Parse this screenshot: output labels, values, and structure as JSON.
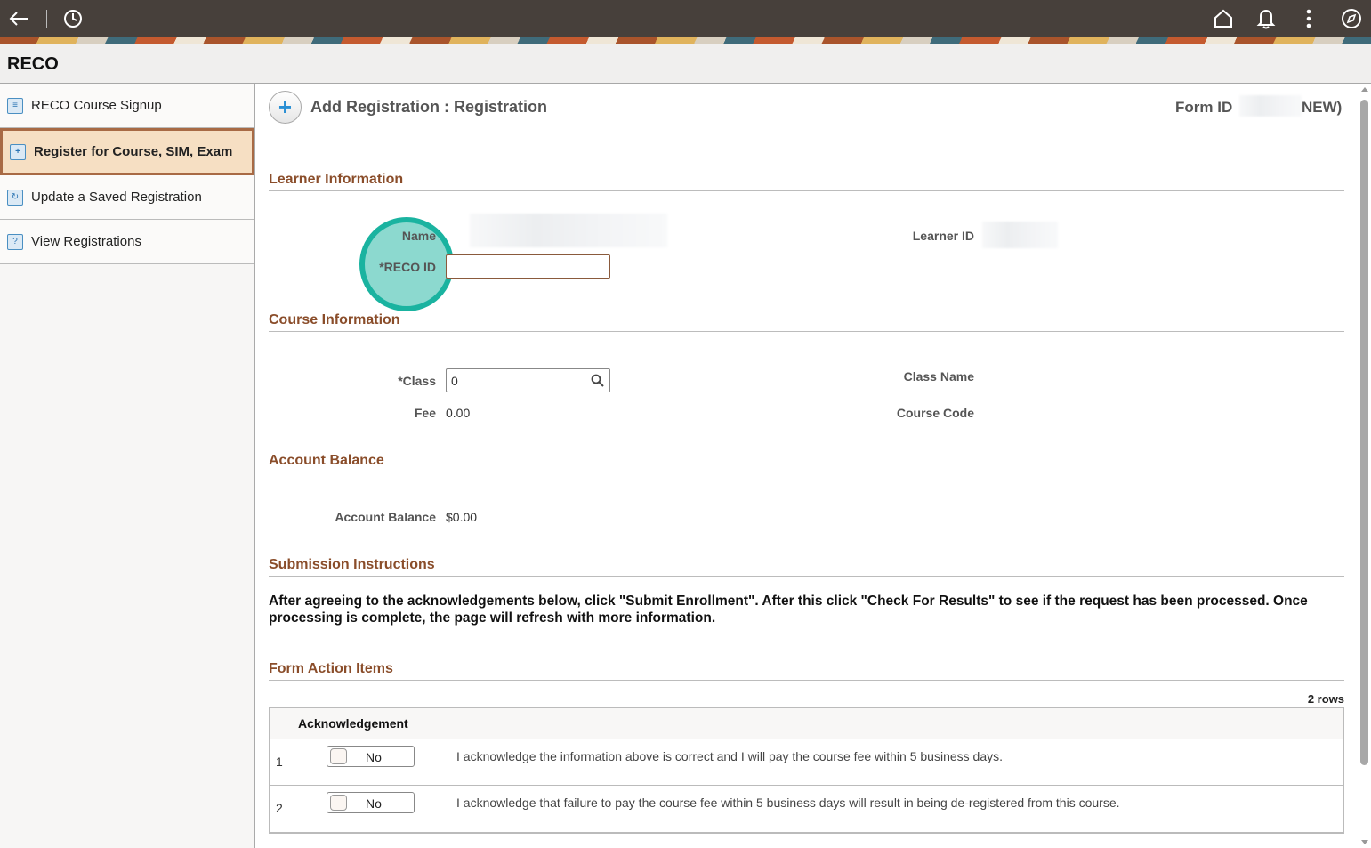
{
  "topbar": {
    "icons": [
      "back-arrow-icon",
      "history-icon",
      "home-icon",
      "bell-icon",
      "more-vertical-icon",
      "compass-icon"
    ]
  },
  "app_title": "RECO",
  "sidebar": {
    "items": [
      {
        "label": "RECO Course Signup",
        "icon": "course-list-icon"
      },
      {
        "label": "Register for Course, SIM, Exam",
        "icon": "add-document-icon",
        "active": true
      },
      {
        "label": "Update a Saved Registration",
        "icon": "update-document-icon"
      },
      {
        "label": "View Registrations",
        "icon": "view-document-icon"
      }
    ]
  },
  "header": {
    "title": "Add Registration :  Registration",
    "form_id_label": "Form ID",
    "form_id_suffix": "NEW)"
  },
  "learner": {
    "section": "Learner Information",
    "name_label": "Name",
    "reco_id_label": "*RECO ID",
    "reco_id_value": "",
    "learner_id_label": "Learner ID"
  },
  "course": {
    "section": "Course Information",
    "class_label": "*Class",
    "class_value": "0",
    "fee_label": "Fee",
    "fee_value": "0.00",
    "class_name_label": "Class Name",
    "course_code_label": "Course Code"
  },
  "account": {
    "section": "Account Balance",
    "balance_label": "Account Balance",
    "balance_value": "$0.00"
  },
  "submission": {
    "section": "Submission Instructions",
    "text": "After agreeing to the acknowledgements below, click \"Submit Enrollment\". After this click \"Check For Results\" to see if the request has been processed. Once processing is complete, the page will refresh with more information."
  },
  "actions": {
    "section": "Form Action Items",
    "row_count": "2 rows",
    "column": "Acknowledgement",
    "rows": [
      {
        "num": "1",
        "toggle": "No",
        "text": "I acknowledge the information above is correct and I will pay the course fee within 5 business days."
      },
      {
        "num": "2",
        "toggle": "No",
        "text": "I acknowledge that failure to pay the course fee within 5 business days will result in being de-registered from this course."
      }
    ]
  },
  "colors": {
    "section_heading": "#8a4d2a",
    "active_nav": "#f6dfc3",
    "highlight": "#1ab3a0"
  }
}
